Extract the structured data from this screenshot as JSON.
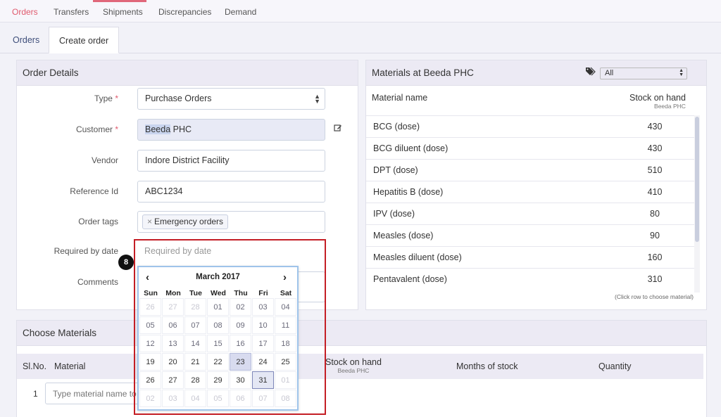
{
  "topnav": {
    "items": [
      "Orders",
      "Transfers",
      "Shipments",
      "Discrepancies",
      "Demand"
    ]
  },
  "subtabs": [
    "Orders",
    "Create order"
  ],
  "order_details": {
    "title": "Order Details",
    "type_label": "Type",
    "type_value": "Purchase Orders",
    "customer_label": "Customer",
    "customer_value_hl": "Beeda",
    "customer_value_rest": " PHC",
    "vendor_label": "Vendor",
    "vendor_value": "Indore District Facility",
    "refid_label": "Reference Id",
    "refid_value": "ABC1234",
    "tags_label": "Order tags",
    "tag_value": "Emergency orders",
    "tag_remove": "×",
    "required_label": "Required by date",
    "required_placeholder": "Required by date",
    "comments_label": "Comments",
    "required_mark": "*"
  },
  "badge": "8",
  "calendar": {
    "month_label": "March 2017",
    "prev": "‹",
    "next": "›",
    "dow": [
      "Sun",
      "Mon",
      "Tue",
      "Wed",
      "Thu",
      "Fri",
      "Sat"
    ],
    "weeks": [
      [
        "26",
        "27",
        "28",
        "01",
        "02",
        "03",
        "04"
      ],
      [
        "05",
        "06",
        "07",
        "08",
        "09",
        "10",
        "11"
      ],
      [
        "12",
        "13",
        "14",
        "15",
        "16",
        "17",
        "18"
      ],
      [
        "19",
        "20",
        "21",
        "22",
        "23",
        "24",
        "25"
      ],
      [
        "26",
        "27",
        "28",
        "29",
        "30",
        "31",
        "01"
      ],
      [
        "02",
        "03",
        "04",
        "05",
        "06",
        "07",
        "08"
      ]
    ],
    "today": "23",
    "selected": "31"
  },
  "materials": {
    "title": "Materials at Beeda PHC",
    "filter_value": "All",
    "col_name": "Material name",
    "col_stock": "Stock on hand",
    "col_stock_sub": "Beeda PHC",
    "rows": [
      {
        "name": "BCG (dose)",
        "stock": "430"
      },
      {
        "name": "BCG diluent (dose)",
        "stock": "430"
      },
      {
        "name": "DPT (dose)",
        "stock": "510"
      },
      {
        "name": "Hepatitis B (dose)",
        "stock": "410"
      },
      {
        "name": "IPV (dose)",
        "stock": "80"
      },
      {
        "name": "Measles (dose)",
        "stock": "90"
      },
      {
        "name": "Measles diluent (dose)",
        "stock": "160"
      },
      {
        "name": "Pentavalent (dose)",
        "stock": "310"
      }
    ],
    "hint": "(Click row to choose material)"
  },
  "choose_materials": {
    "title": "Choose Materials",
    "col_slno": "Sl.No.",
    "col_material": "Material",
    "col_stock": "Stock on hand",
    "col_stock_sub": "Beeda PHC",
    "col_months": "Months of stock",
    "col_quantity": "Quantity",
    "row_num": "1",
    "input_placeholder": "Type material name to choose"
  }
}
